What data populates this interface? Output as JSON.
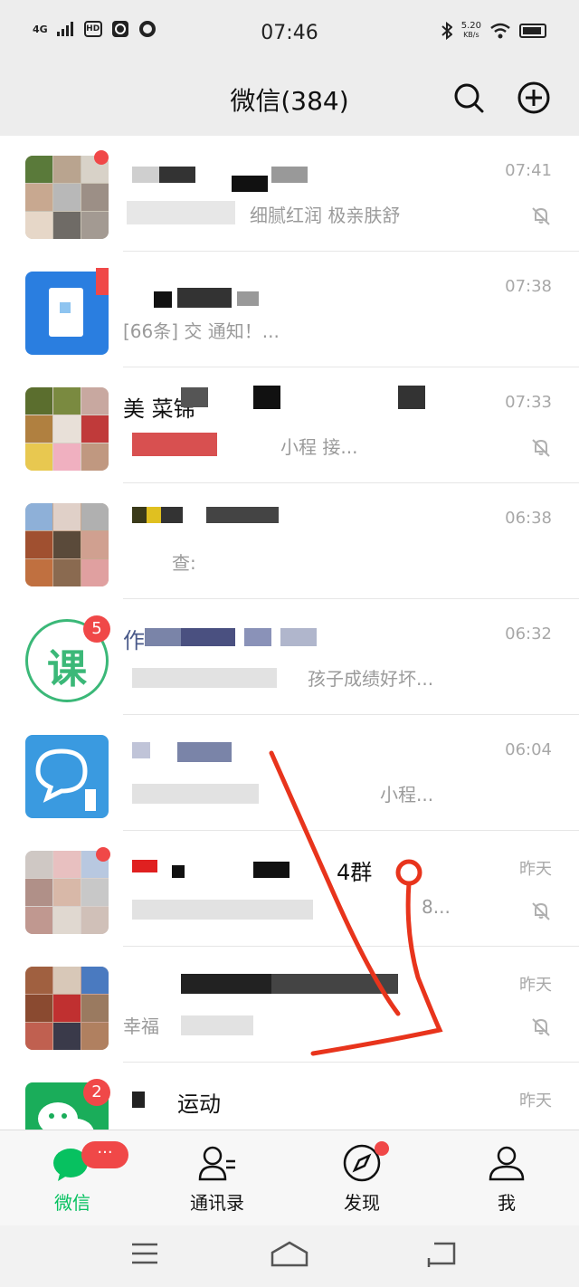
{
  "status_bar": {
    "network": "4G",
    "hd": "HD",
    "time": "07:46",
    "speed": "5.20",
    "speed_unit": "KB/s"
  },
  "header": {
    "title": "微信(384)",
    "search_icon": "search-icon",
    "add_icon": "plus-circle-icon"
  },
  "chats": [
    {
      "name": "",
      "preview": "细腻红润 极亲肤舒",
      "time": "07:41",
      "muted": true,
      "badge": "dot"
    },
    {
      "name": "",
      "preview": "[66条] 交 通知！...",
      "time": "07:38",
      "muted": false,
      "badge": "dot"
    },
    {
      "name": "美 菜锦",
      "preview": "小程 接...",
      "time": "07:33",
      "muted": true,
      "badge": "dot"
    },
    {
      "name": "",
      "preview": "查:",
      "time": "06:38",
      "muted": false,
      "badge": ""
    },
    {
      "name": "作",
      "preview": "孩子成绩好坏...",
      "time": "06:32",
      "muted": false,
      "badge": "5",
      "avatar_text": "课"
    },
    {
      "name": "",
      "preview": "小程...",
      "time": "06:04",
      "muted": false,
      "badge": ""
    },
    {
      "name": "4群",
      "preview": "8...",
      "time": "昨天",
      "muted": true,
      "badge": "dot"
    },
    {
      "name": "",
      "preview": "幸福",
      "time": "昨天",
      "muted": true,
      "badge": ""
    },
    {
      "name": "运动",
      "preview": "",
      "time": "昨天",
      "muted": false,
      "badge": "2"
    }
  ],
  "tabs": [
    {
      "label": "微信",
      "icon": "chat-bubbles-icon",
      "active": true,
      "badge": "···"
    },
    {
      "label": "通讯录",
      "icon": "contacts-icon",
      "active": false
    },
    {
      "label": "发现",
      "icon": "compass-icon",
      "active": false,
      "badge": "dot"
    },
    {
      "label": "我",
      "icon": "person-icon",
      "active": false
    }
  ],
  "colors": {
    "brand_green": "#07c160",
    "badge_red": "#f04848",
    "annotation_red": "#e8341c"
  }
}
